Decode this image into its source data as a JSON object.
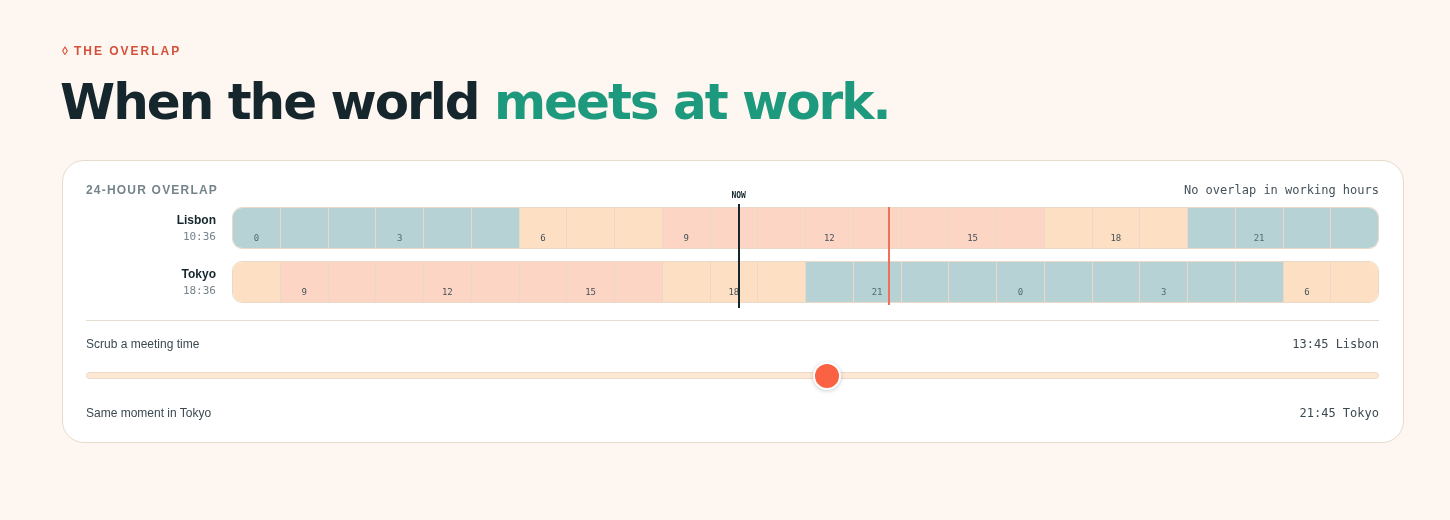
{
  "eyebrow": {
    "icon": "◊",
    "text": "THE OVERLAP"
  },
  "heading": {
    "plain": "When the world",
    "accent": "meets at work."
  },
  "card": {
    "title": "24-HOUR OVERLAP",
    "status": "No overlap in working hours",
    "now": {
      "label": "NOW",
      "level": 0.4417
    },
    "scrub_line": {
      "level": 0.573
    },
    "cities": [
      {
        "name": "Lisbon",
        "time": "10:36",
        "cells": [
          {
            "kind": "night",
            "label": "0"
          },
          {
            "kind": "night"
          },
          {
            "kind": "night"
          },
          {
            "kind": "night",
            "label": "3"
          },
          {
            "kind": "night"
          },
          {
            "kind": "night"
          },
          {
            "kind": "edge",
            "label": "6"
          },
          {
            "kind": "edge"
          },
          {
            "kind": "edge"
          },
          {
            "kind": "work",
            "label": "9"
          },
          {
            "kind": "work"
          },
          {
            "kind": "work"
          },
          {
            "kind": "work",
            "label": "12"
          },
          {
            "kind": "work"
          },
          {
            "kind": "work"
          },
          {
            "kind": "work",
            "label": "15"
          },
          {
            "kind": "work"
          },
          {
            "kind": "edge"
          },
          {
            "kind": "edge",
            "label": "18"
          },
          {
            "kind": "edge"
          },
          {
            "kind": "night"
          },
          {
            "kind": "night",
            "label": "21"
          },
          {
            "kind": "night"
          },
          {
            "kind": "night"
          }
        ]
      },
      {
        "name": "Tokyo",
        "time": "18:36",
        "cells": [
          {
            "kind": "edge"
          },
          {
            "kind": "work",
            "label": "9"
          },
          {
            "kind": "work"
          },
          {
            "kind": "work"
          },
          {
            "kind": "work",
            "label": "12"
          },
          {
            "kind": "work"
          },
          {
            "kind": "work"
          },
          {
            "kind": "work",
            "label": "15"
          },
          {
            "kind": "work"
          },
          {
            "kind": "edge"
          },
          {
            "kind": "edge",
            "label": "18"
          },
          {
            "kind": "edge"
          },
          {
            "kind": "night"
          },
          {
            "kind": "night",
            "label": "21"
          },
          {
            "kind": "night"
          },
          {
            "kind": "night"
          },
          {
            "kind": "night",
            "label": "0"
          },
          {
            "kind": "night"
          },
          {
            "kind": "night"
          },
          {
            "kind": "night",
            "label": "3"
          },
          {
            "kind": "night"
          },
          {
            "kind": "night"
          },
          {
            "kind": "edge",
            "label": "6"
          },
          {
            "kind": "edge"
          }
        ]
      }
    ],
    "scrub": {
      "label": "Scrub a meeting time",
      "reading": "13:45 Lisbon",
      "level": 0.573
    },
    "result": {
      "label": "Same moment in Tokyo",
      "reading": "21:45 Tokyo"
    }
  }
}
